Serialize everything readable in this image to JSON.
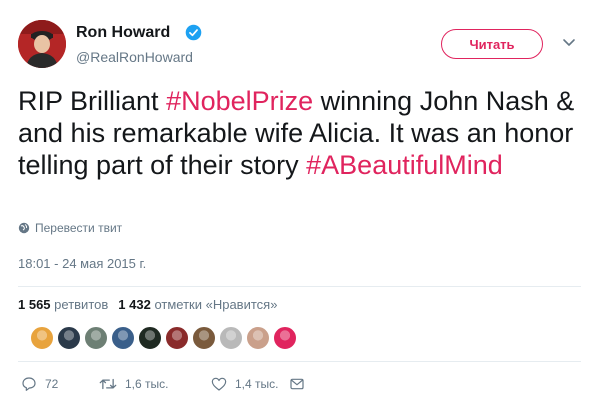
{
  "author": {
    "name": "Ron Howard",
    "handle": "@RealRonHoward",
    "follow_label": "Читать"
  },
  "tweet": {
    "segments": [
      {
        "text": "RIP Brilliant ",
        "type": "text"
      },
      {
        "text": "#NobelPrize",
        "type": "hashtag"
      },
      {
        "text": " winning John Nash & and his remarkable wife Alicia. It was an honor telling part of their story ",
        "type": "text"
      },
      {
        "text": "#ABeautifulMind",
        "type": "hashtag"
      }
    ]
  },
  "translate_label": "Перевести твит",
  "timestamp": "18:01 - 24 мая 2015 г.",
  "stats": {
    "retweets_count": "1 565",
    "retweets_label": "ретвитов",
    "likes_count": "1 432",
    "likes_label": "отметки «Нравится»"
  },
  "likers": [
    {
      "color": "#e8a33d"
    },
    {
      "color": "#2b3a4a"
    },
    {
      "color": "#6d7f74"
    },
    {
      "color": "#3a5f8a"
    },
    {
      "color": "#1f2a22"
    },
    {
      "color": "#8a2b2b"
    },
    {
      "color": "#7a5a3c"
    },
    {
      "color": "#b9b9b9"
    },
    {
      "color": "#caa08b"
    },
    {
      "color": "#e0245e"
    }
  ],
  "actions": {
    "reply_count": "72",
    "retweet_count": "1,6 тыс.",
    "like_count": "1,4 тыс."
  },
  "colors": {
    "accent": "#e0245e",
    "verified": "#1da1f2",
    "muted": "#657786"
  }
}
